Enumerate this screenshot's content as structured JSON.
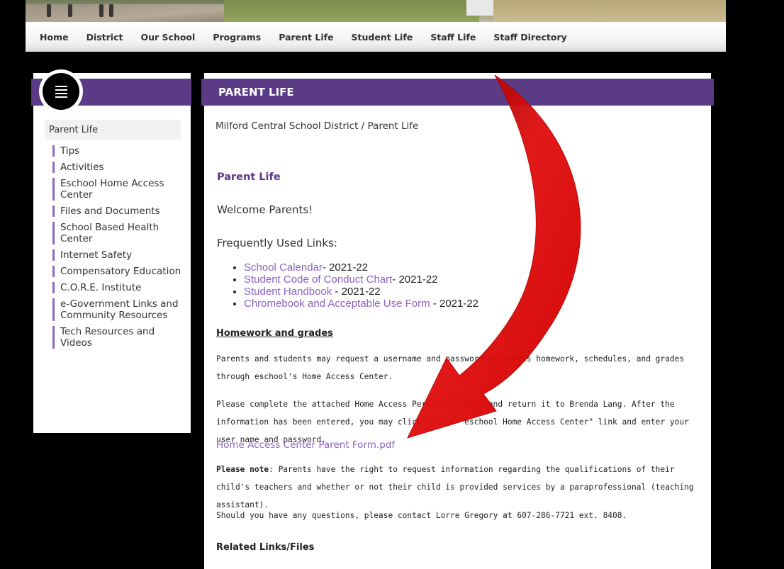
{
  "nav": {
    "items": [
      "Home",
      "District",
      "Our School",
      "Programs",
      "Parent Life",
      "Student Life",
      "Staff Life",
      "Staff Directory"
    ]
  },
  "sidebar": {
    "current": "Parent Life",
    "items": [
      "Tips",
      "Activities",
      "Eschool Home Access Center",
      "Files and Documents",
      "School Based Health Center",
      "Internet Safety",
      "Compensatory Education",
      "C.O.R.E. Institute",
      "e-Government Links and Community Resources",
      "Tech Resources and Videos"
    ]
  },
  "main": {
    "header": "PARENT LIFE",
    "breadcrumb": "Milford Central School District / Parent Life",
    "heading": "Parent Life",
    "welcome": "Welcome Parents!",
    "frequent_heading": "Frequently Used Links:",
    "links": [
      {
        "label": "School Calendar",
        "suffix": "- 2021-22"
      },
      {
        "label": "Student Code of Conduct Chart",
        "suffix": "- 2021-22"
      },
      {
        "label": "Student Handbook",
        "suffix": " - 2021-22"
      },
      {
        "label": "Chromebook and Acceptable Use Form",
        "suffix": " - 2021-22"
      }
    ],
    "homework_heading": "Homework and grades",
    "para1": "Parents and students may request a username and password to access homework, schedules, and grades through eschool's Home Access Center.",
    "para2": "Please complete the attached Home Access Permission form and return it to Brenda Lang. After the information has been entered, you may click on the \"eschool Home Access Center\" link and enter your user name and password.",
    "pdf_link": "Home Access Center Parent Form.pdf",
    "note_label": "Please note",
    "note_text": ": Parents have the right to request information regarding the qualifications of their child's teachers and whether or not their child is provided services by a paraprofessional (teaching assistant).",
    "contact": "Should you have any questions, please contact Lorre Gregory at 607-286-7721 ext. 8408.",
    "related": "Related Links/Files"
  },
  "colors": {
    "purple": "#5b3a86",
    "link": "#8a64c2",
    "arrow": "#d40000"
  },
  "icons": {
    "menu": "hamburger-icon",
    "arrow": "red-curved-arrow"
  }
}
